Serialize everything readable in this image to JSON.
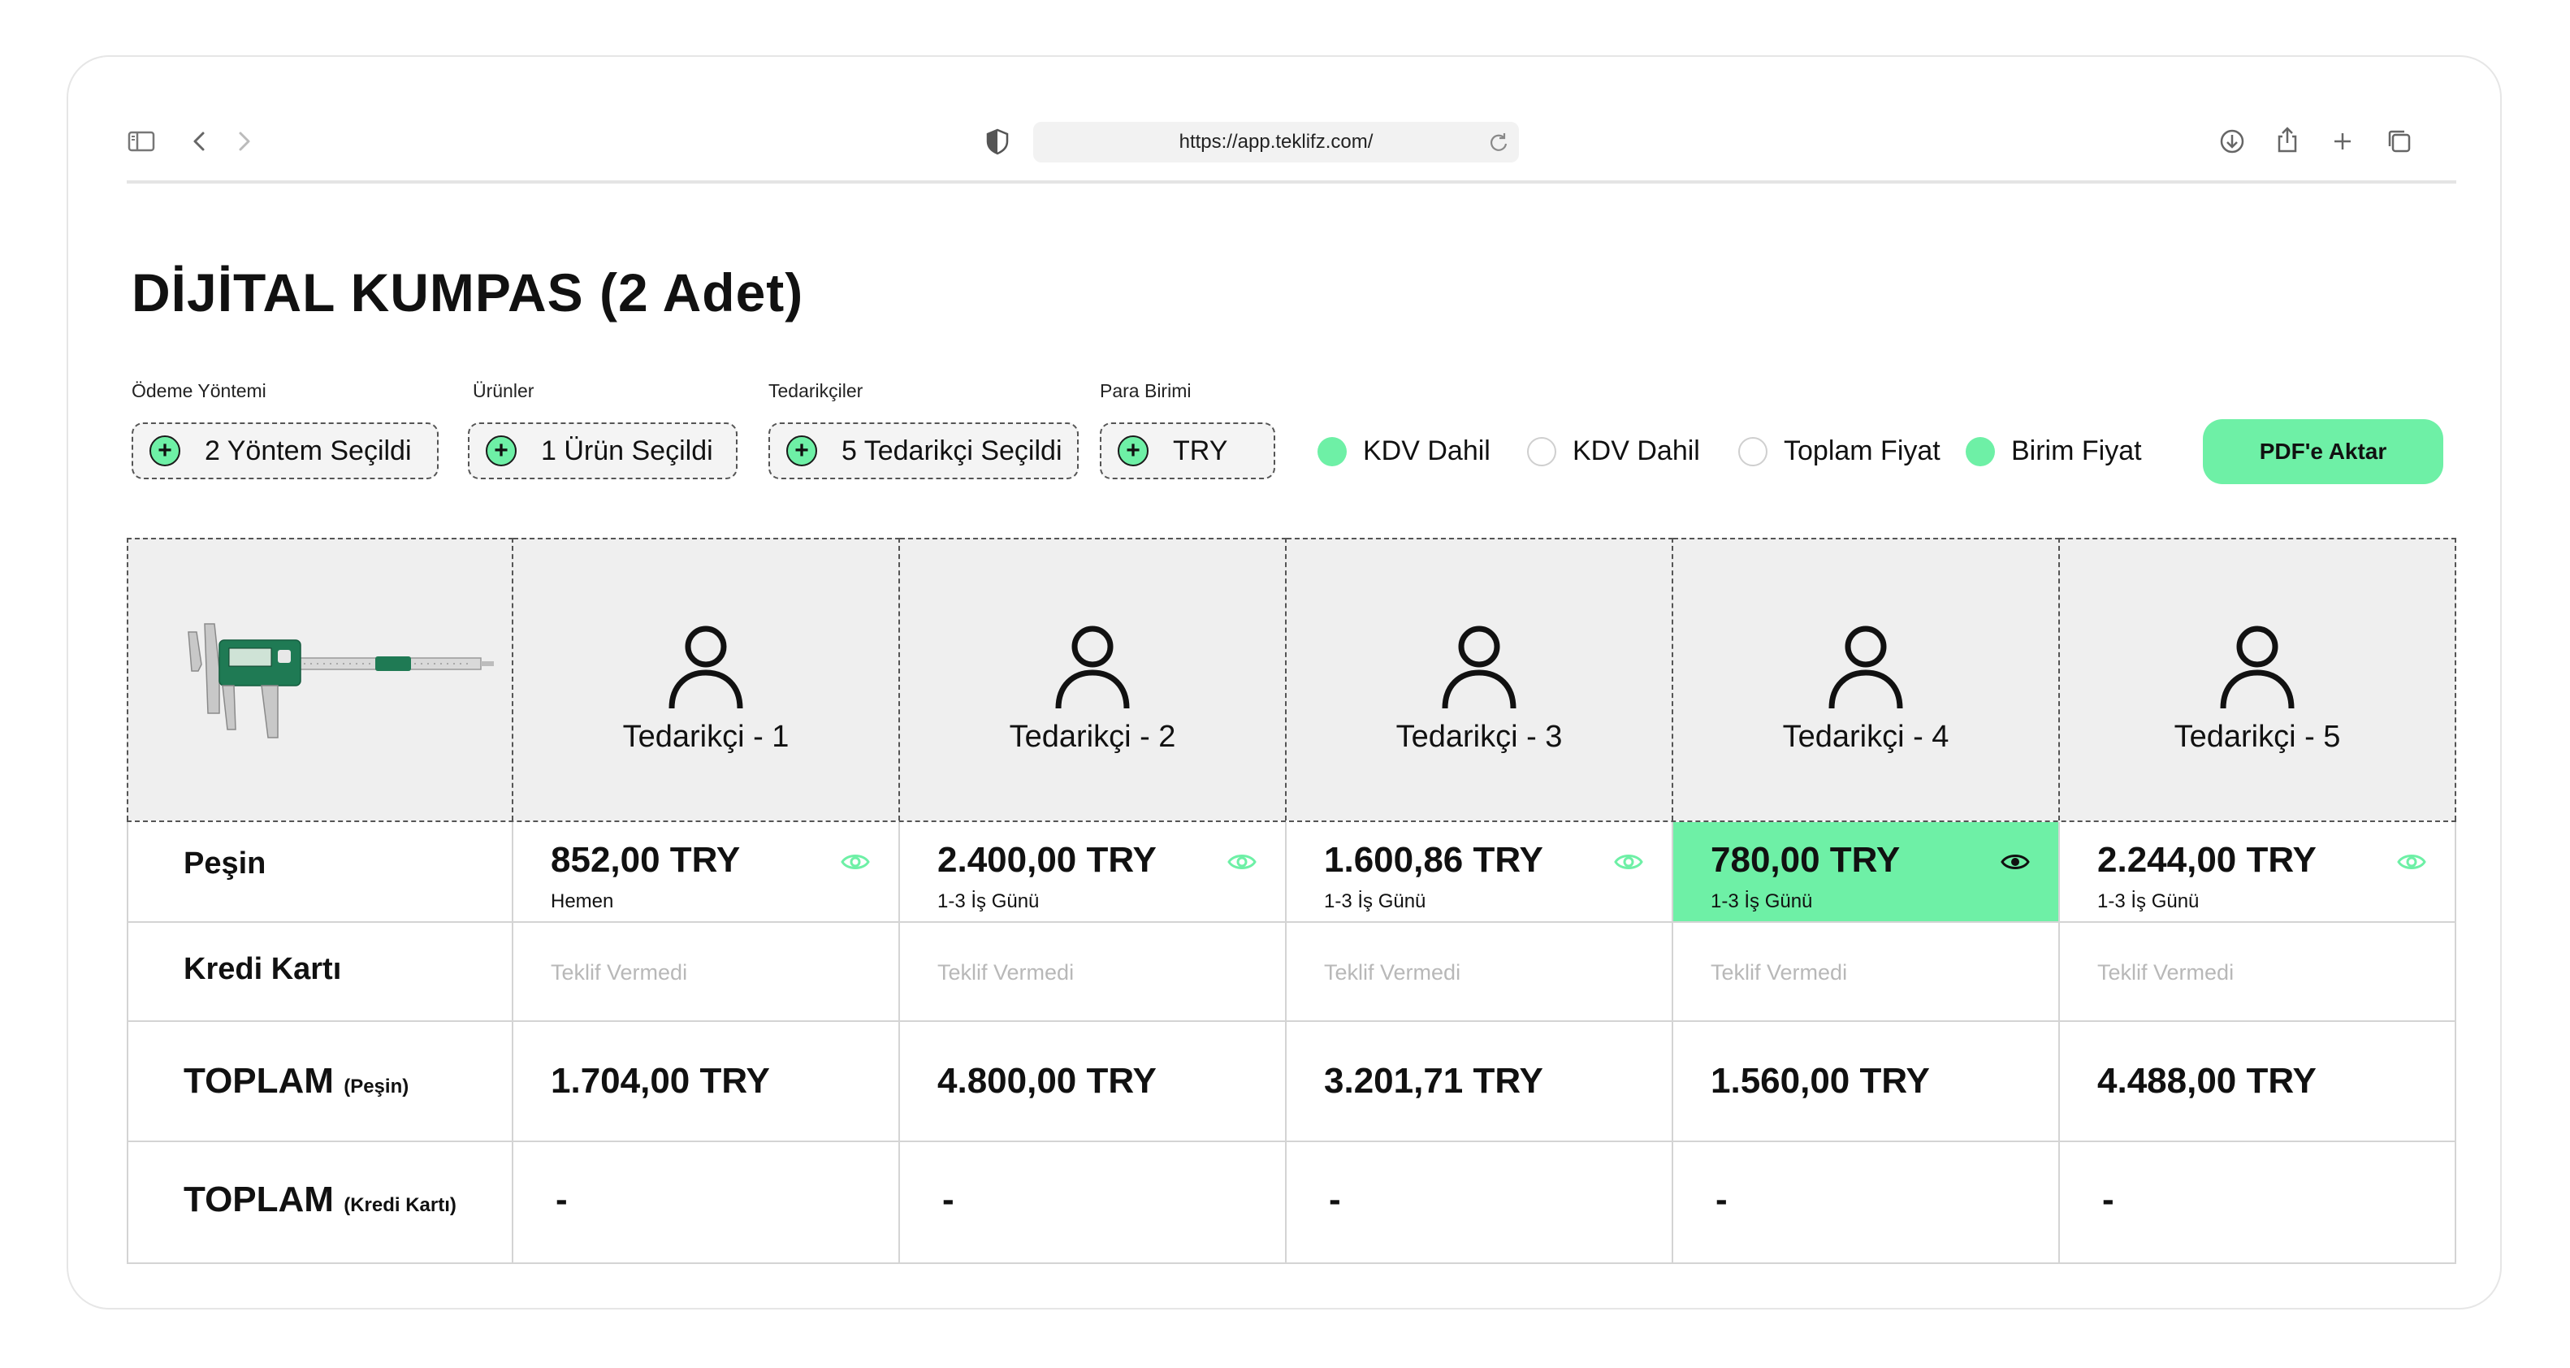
{
  "browser": {
    "url": "https://app.teklifz.com/"
  },
  "page": {
    "title": "DİJİTAL KUMPAS (2 Adet)"
  },
  "filters": {
    "payment": {
      "label": "Ödeme Yöntemi",
      "value": "2 Yöntem Seçildi"
    },
    "products": {
      "label": "Ürünler",
      "value": "1 Ürün Seçildi"
    },
    "suppliers": {
      "label": "Tedarikçiler",
      "value": "5 Tedarikçi Seçildi"
    },
    "currency": {
      "label": "Para Birimi",
      "value": "TRY"
    }
  },
  "toggles": [
    {
      "label": "KDV Dahil",
      "selected": true
    },
    {
      "label": "KDV Dahil",
      "selected": false
    },
    {
      "label": "Toplam Fiyat",
      "selected": false
    },
    {
      "label": "Birim Fiyat",
      "selected": true
    }
  ],
  "actions": {
    "export_label": "PDF'e Aktar"
  },
  "table": {
    "suppliers": [
      "Tedarikçi - 1",
      "Tedarikçi - 2",
      "Tedarikçi - 3",
      "Tedarikçi - 4",
      "Tedarikçi - 5"
    ],
    "rows": {
      "cash": {
        "label": "Peşin",
        "cells": [
          {
            "price": "852,00 TRY",
            "delivery": "Hemen",
            "highlighted": false
          },
          {
            "price": "2.400,00 TRY",
            "delivery": "1-3 İş Günü",
            "highlighted": false
          },
          {
            "price": "1.600,86 TRY",
            "delivery": "1-3 İş Günü",
            "highlighted": false
          },
          {
            "price": "780,00 TRY",
            "delivery": "1-3 İş Günü",
            "highlighted": true
          },
          {
            "price": "2.244,00 TRY",
            "delivery": "1-3 İş Günü",
            "highlighted": false
          }
        ]
      },
      "card": {
        "label": "Kredi Kartı",
        "cells": [
          "Teklif Vermedi",
          "Teklif Vermedi",
          "Teklif Vermedi",
          "Teklif Vermedi",
          "Teklif Vermedi"
        ]
      },
      "total_cash": {
        "label": "TOPLAM",
        "sub": "(Peşin)",
        "cells": [
          "1.704,00 TRY",
          "4.800,00 TRY",
          "3.201,71 TRY",
          "1.560,00 TRY",
          "4.488,00 TRY"
        ]
      },
      "total_card": {
        "label": "TOPLAM",
        "sub": "(Kredi Kartı)",
        "cells": [
          "-",
          "-",
          "-",
          "-",
          "-"
        ]
      }
    }
  },
  "colors": {
    "accent": "#6ef0a6",
    "header_bg": "#efefef",
    "muted_text": "#b8b8b8"
  }
}
